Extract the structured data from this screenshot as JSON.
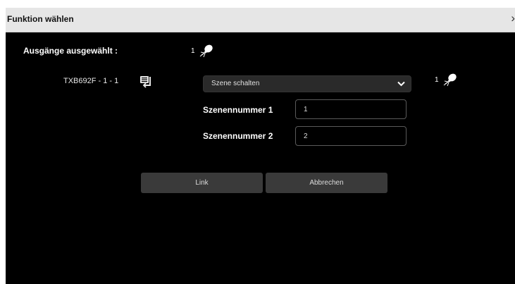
{
  "dialog": {
    "title": "Funktion wählen",
    "close_glyph": "›"
  },
  "outputs": {
    "label": "Ausgänge ausgewählt :",
    "count": "1",
    "icon": "light-bulb-icon"
  },
  "device": {
    "name": "TXB692F - 1 - 1",
    "icon": "device-transfer-icon",
    "function_select": "Szene schalten",
    "right_count": "1",
    "right_icon": "light-bulb-icon"
  },
  "scenes": {
    "label1": "Szenennummer 1",
    "value1": "1",
    "label2": "Szenennummer 2",
    "value2": "2"
  },
  "buttons": {
    "link": "Link",
    "cancel": "Abbrechen"
  },
  "colors": {
    "background": "#000000",
    "titlebar": "#e6e6e6",
    "button": "#3a3a3a"
  }
}
